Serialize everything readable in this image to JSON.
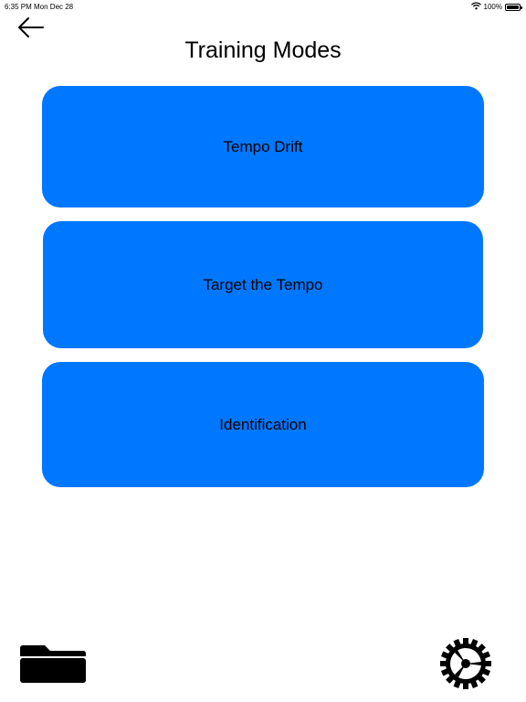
{
  "status_bar": {
    "time": "6:35 PM",
    "date": "Mon Dec 28",
    "battery_text": "100%",
    "battery_level": 1.0,
    "icons": [
      "wifi-icon",
      "battery-icon"
    ]
  },
  "header": {
    "title": "Training Modes",
    "back_icon": "arrow-left-icon"
  },
  "modes": [
    {
      "label": "Tempo Drift"
    },
    {
      "label": "Target the Tempo"
    },
    {
      "label": "Identification"
    }
  ],
  "footer": {
    "left_icon": "folder-icon",
    "right_icon": "gear-icon"
  },
  "colors": {
    "accent": "#0077ff",
    "background": "#ffffff",
    "text": "#000000"
  }
}
